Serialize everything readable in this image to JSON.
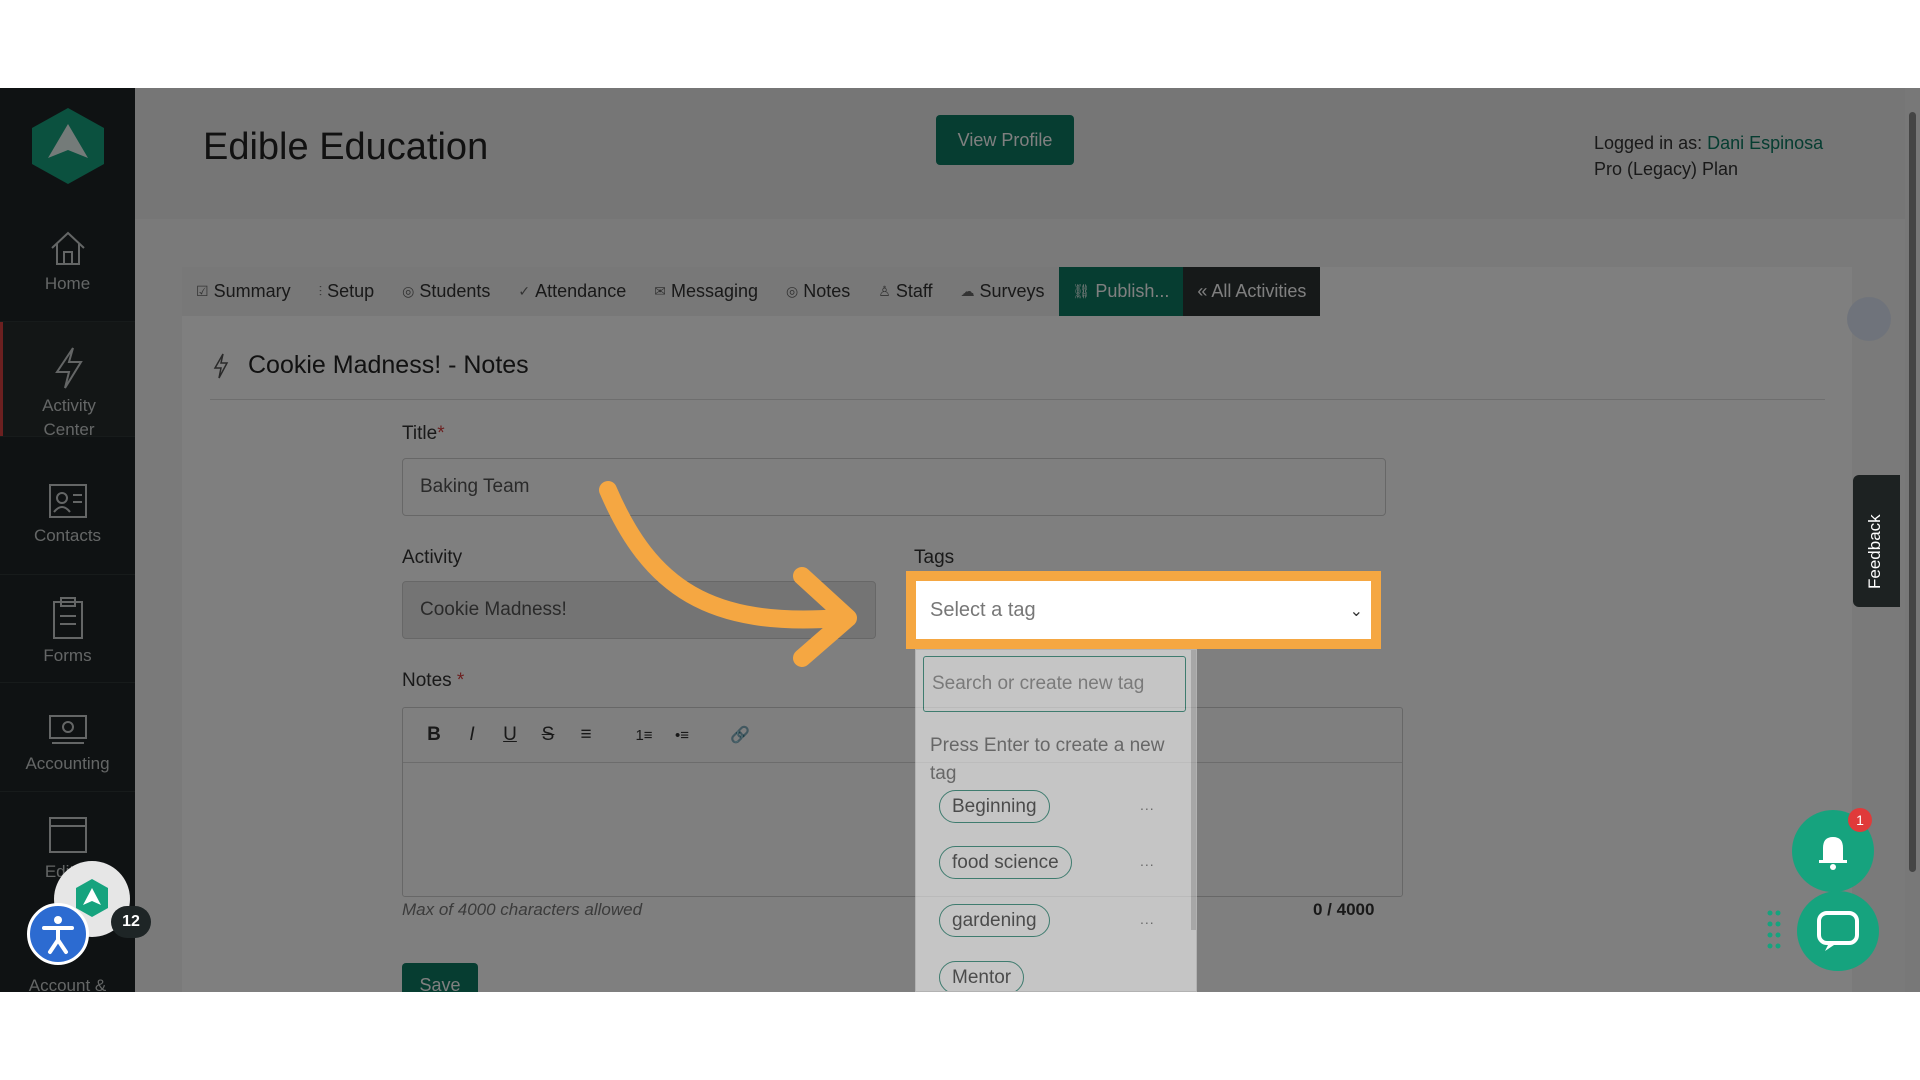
{
  "app": {
    "title": "Edible Education",
    "view_profile": "View Profile",
    "logged_in_prefix": "Logged in as:",
    "user": "Dani Espinosa",
    "plan": "Pro (Legacy) Plan"
  },
  "sidebar": {
    "items": [
      {
        "label": "Home",
        "icon": "home-icon"
      },
      {
        "label": "Activity",
        "label2": "Center",
        "icon": "bolt-icon"
      },
      {
        "label": "Contacts",
        "icon": "contacts-icon"
      },
      {
        "label": "Forms",
        "icon": "clipboard-icon"
      },
      {
        "label": "Accounting",
        "icon": "cash-icon"
      },
      {
        "label": "Edit P",
        "icon": "browser-icon"
      },
      {
        "label": "Account &",
        "icon": "gear-icon"
      }
    ],
    "badge": "12"
  },
  "tabs": [
    {
      "label": "Summary",
      "glyph": "☑"
    },
    {
      "label": "Setup",
      "glyph": "⫶"
    },
    {
      "label": "Students",
      "glyph": "◎"
    },
    {
      "label": "Attendance",
      "glyph": "✓"
    },
    {
      "label": "Messaging",
      "glyph": "✉"
    },
    {
      "label": "Notes",
      "glyph": "◎"
    },
    {
      "label": "Staff",
      "glyph": "♙"
    },
    {
      "label": "Surveys",
      "glyph": "☁"
    },
    {
      "label": "Publish...",
      "glyph": "⛓"
    },
    {
      "label": "« All Activities",
      "glyph": ""
    }
  ],
  "page": {
    "heading": "Cookie Madness! - Notes",
    "title_label": "Title",
    "title_value": "Baking Team",
    "activity_label": "Activity",
    "activity_value": "Cookie Madness!",
    "tags_label": "Tags",
    "tags_placeholder": "Select a tag",
    "notes_label": "Notes",
    "req_mark": "*",
    "notes_help": "Max of 4000 characters allowed",
    "notes_count": "0 / 4000",
    "save": "Save"
  },
  "toolbar": [
    "B",
    "I",
    "U",
    "S",
    "≡",
    "1≡",
    "•≡",
    "🔗"
  ],
  "tag_dropdown": {
    "search_placeholder": "Search or create new tag",
    "hint": "Press Enter to create a new tag",
    "tags": [
      "Beginning",
      "food science",
      "gardening",
      "Mentor"
    ],
    "more": "..."
  },
  "widgets": {
    "feedback": "Feedback",
    "bell_count": "1"
  },
  "colors": {
    "brand": "#0c7a63",
    "highlight": "#f5a742",
    "sidebar": "#1f2526"
  }
}
